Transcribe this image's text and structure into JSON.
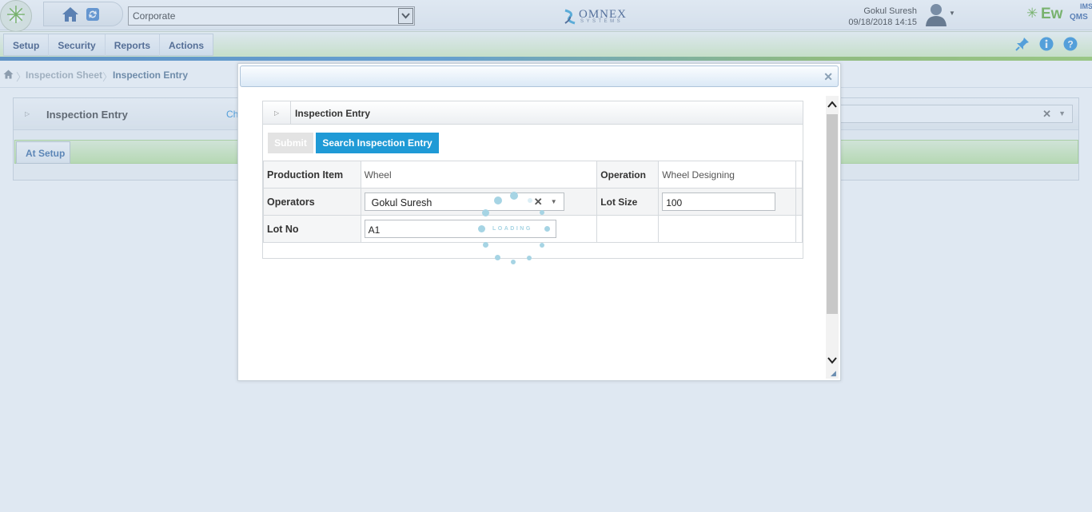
{
  "header": {
    "corporate_select": "Corporate",
    "brand_omnex": "OMNEX",
    "brand_systems": "SYSTEMS",
    "user_name": "Gokul Suresh",
    "datetime": "09/18/2018 14:15",
    "ewqms_ew": "Ew",
    "ewqms_ims": "IMS",
    "ewqms_qms": "QMS"
  },
  "menubar": {
    "items": [
      "Setup",
      "Security",
      "Reports",
      "Actions"
    ]
  },
  "breadcrumb": {
    "items": [
      "Inspection Sheet",
      "Inspection Entry"
    ]
  },
  "page": {
    "panel_title": "Inspection Entry",
    "partial_link": "Ch",
    "tab_label": "At Setup"
  },
  "modal": {
    "title": "Inspection Entry",
    "submit_label": "Submit",
    "search_label": "Search Inspection Entry",
    "loading_text": "LOADING",
    "fields": {
      "production_item_label": "Production Item",
      "production_item_value": "Wheel",
      "operation_label": "Operation",
      "operation_value": "Wheel Designing",
      "operators_label": "Operators",
      "operators_value": "Gokul Suresh",
      "lot_size_label": "Lot Size",
      "lot_size_value": "100",
      "lot_no_label": "Lot No",
      "lot_no_value": "A1"
    }
  },
  "colors": {
    "accent_blue": "#1f9ad6",
    "menu_green": "#d6f0bd",
    "brand_green": "#5aa82a"
  }
}
